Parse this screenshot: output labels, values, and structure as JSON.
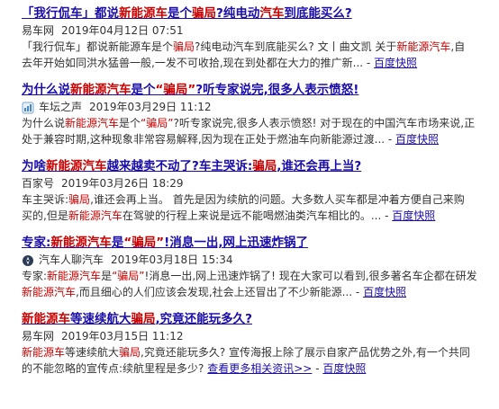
{
  "results": [
    {
      "title": [
        "「我行侃车」都说",
        "新能源车",
        "是个",
        "骗局",
        "?纯电动",
        "汽车",
        "到底能买么?"
      ],
      "source": "易车网",
      "date": "2019年04月12日 07:51",
      "icon": "",
      "snippet_line1": [
        "「我行侃车」都说新能源车是个",
        "骗局",
        "?纯电动汽车到底能买么? 文丨曲文凯 关于",
        "新能源汽车",
        ",自"
      ],
      "snippet_line2_text": "去年开始如同洪水猛兽一般,一发不可收拾,现在到处都在大力的推广新...",
      "snapshot": "百度快照"
    },
    {
      "title": [
        "为什么说",
        "新能源汽车",
        "是个",
        "“骗局”",
        "?听专家说完,很多人表示愤怒!"
      ],
      "source": "车坛之声",
      "date": "2019年03月29日 11:12",
      "icon": "chart-icon",
      "snippet_line1": [
        "为什么说",
        "新能源汽车",
        "是个",
        "“骗局”",
        "?听专家说完,很多人表示愤怒! 对于现在的中国汽车市场来说,正"
      ],
      "snippet_line2_text": "处于兼容时期,这种现象非常容易解释,因为现在正处于燃油车向新能源过渡...",
      "snapshot": "百度快照"
    },
    {
      "title": [
        "为啥",
        "新能源汽车",
        "越来越卖不动了?车主哭诉:",
        "骗局",
        ",谁还会再上当?"
      ],
      "source": "百家号",
      "date": "2019年03月26日 18:29",
      "icon": "",
      "snippet_line1": [
        "车主哭诉:",
        "骗局",
        ",谁还会再上当。 首先是因为续航的问题。大多数人买车都是冲着方便自己来购"
      ],
      "snippet_line2": [
        "买的,但是",
        "新能源汽车",
        "在驾驶的行程上来说是远不能喝燃油类汽车相比的。..."
      ],
      "snapshot": "百度快照"
    },
    {
      "title": [
        "专家:",
        "新能源汽车",
        "是",
        "“骗局”",
        "!消息一出,网上迅速炸锅了"
      ],
      "source": "汽车人聊汽车",
      "date": "2019年03月18日 15:34",
      "icon": "compass-icon",
      "snippet_line1": [
        "专家:",
        "新能源汽车",
        "是",
        "“骗局”",
        "!消息一出,网上迅速炸锅了! 现在大家可以看到,很多著名车企都在研发"
      ],
      "snippet_line2": [
        "新能源汽车",
        ",而且细心的人们应该会发现,社会上还冒出了不少新能源..."
      ],
      "snapshot": "百度快照"
    },
    {
      "title": [
        "新能源车",
        "等速续航大",
        "骗局",
        ",究竟还能玩多久?"
      ],
      "source": "易车网",
      "date": "2019年03月15日 11:12",
      "icon": "",
      "snippet_line1": [
        "新能源车",
        "等速续航大",
        "骗局",
        ",究竟还能玩多久? 宣传海报上除了展示自家产品优势之外,有一个共同"
      ],
      "snippet_line2_text": "的不能忽略的宣传点:续航里程是多少?",
      "more_link": "查看更多相关资讯>>",
      "snapshot": "百度快照"
    }
  ]
}
